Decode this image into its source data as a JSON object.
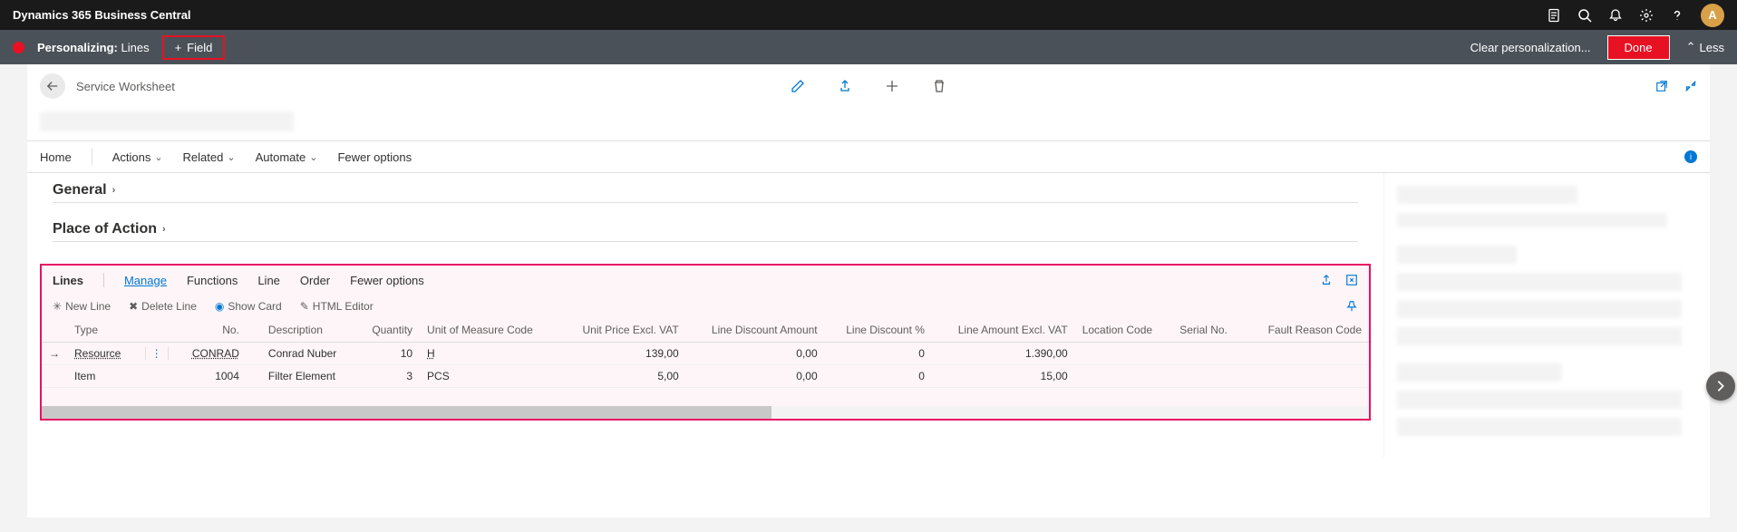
{
  "app_title": "Dynamics 365 Business Central",
  "avatar_letter": "A",
  "personalize": {
    "prefix": "Personalizing:",
    "target": "Lines",
    "field_btn": "Field",
    "clear": "Clear personalization...",
    "done": "Done",
    "less": "Less"
  },
  "breadcrumb": "Service Worksheet",
  "toolbar": {
    "home": "Home",
    "actions": "Actions",
    "related": "Related",
    "automate": "Automate",
    "fewer": "Fewer options"
  },
  "sections": {
    "general": "General",
    "place": "Place of Action"
  },
  "lines": {
    "title": "Lines",
    "tabs": {
      "manage": "Manage",
      "functions": "Functions",
      "line": "Line",
      "order": "Order",
      "fewer": "Fewer options"
    },
    "actions": {
      "new": "New Line",
      "delete": "Delete Line",
      "show": "Show Card",
      "html": "HTML Editor"
    },
    "headers": {
      "type": "Type",
      "no": "No.",
      "desc": "Description",
      "qty": "Quantity",
      "uom": "Unit of Measure Code",
      "unitprice": "Unit Price Excl. VAT",
      "discamt": "Line Discount Amount",
      "discpct": "Line Discount %",
      "lineamt": "Line Amount Excl. VAT",
      "loc": "Location Code",
      "serial": "Serial No.",
      "fault": "Fault Reason Code"
    },
    "rows": [
      {
        "type": "Resource",
        "no": "CONRAD",
        "desc": "Conrad Nuber",
        "qty": "10",
        "uom": "H",
        "unitprice": "139,00",
        "discamt": "0,00",
        "discpct": "0",
        "lineamt": "1.390,00",
        "loc": "",
        "serial": "",
        "fault": ""
      },
      {
        "type": "Item",
        "no": "1004",
        "desc": "Filter Element",
        "qty": "3",
        "uom": "PCS",
        "unitprice": "5,00",
        "discamt": "0,00",
        "discpct": "0",
        "lineamt": "15,00",
        "loc": "",
        "serial": "",
        "fault": ""
      }
    ]
  }
}
